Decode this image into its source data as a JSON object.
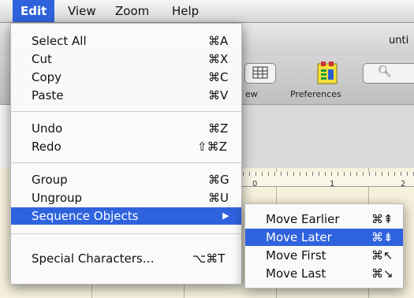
{
  "menubar": {
    "items": [
      {
        "label": "Edit",
        "active": true
      },
      {
        "label": "View",
        "active": false
      },
      {
        "label": "Zoom",
        "active": false
      },
      {
        "label": "Help",
        "active": false
      }
    ]
  },
  "window": {
    "title_fragment": "unti",
    "toolbar": {
      "view_label": "ew",
      "preferences_label": "Preferences"
    },
    "ruler": {
      "ticks": [
        "0",
        "1",
        "2"
      ]
    }
  },
  "edit_menu": {
    "items": [
      {
        "label": "Select All",
        "shortcut": "⌘A"
      },
      {
        "label": "Cut",
        "shortcut": "⌘X"
      },
      {
        "label": "Copy",
        "shortcut": "⌘C"
      },
      {
        "label": "Paste",
        "shortcut": "⌘V"
      },
      {
        "label": "Undo",
        "shortcut": "⌘Z"
      },
      {
        "label": "Redo",
        "shortcut": "⇧⌘Z"
      },
      {
        "label": "Group",
        "shortcut": "⌘G"
      },
      {
        "label": "Ungroup",
        "shortcut": "⌘U"
      },
      {
        "label": "Sequence Objects",
        "submenu_arrow": "▶"
      },
      {
        "label": "Special Characters…",
        "shortcut": "⌥⌘T"
      }
    ]
  },
  "sequence_submenu": {
    "items": [
      {
        "label": "Move Earlier",
        "shortcut": "⌘⇞"
      },
      {
        "label": "Move Later",
        "shortcut": "⌘⇟"
      },
      {
        "label": "Move First",
        "shortcut": "⌘↖"
      },
      {
        "label": "Move Last",
        "shortcut": "⌘↘"
      }
    ]
  },
  "colors": {
    "highlight": "#2f63de",
    "workspace": "#f6f1dc"
  }
}
